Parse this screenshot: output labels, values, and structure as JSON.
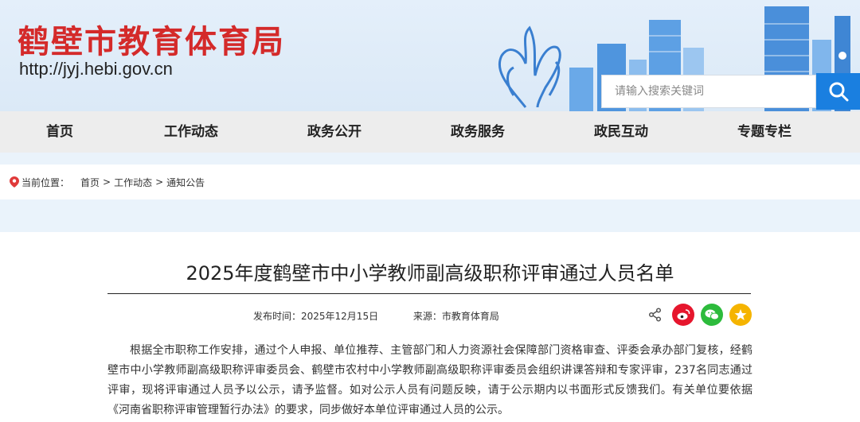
{
  "header": {
    "site_title": "鹤壁市教育体育局",
    "site_url": "http://jyj.hebi.gov.cn",
    "search_placeholder": "请输入搜索关键词"
  },
  "nav": {
    "items": [
      "首页",
      "工作动态",
      "政务公开",
      "政务服务",
      "政民互动",
      "专题专栏"
    ]
  },
  "breadcrumb": {
    "label": "当前位置：",
    "items": [
      "首页",
      "工作动态",
      "通知公告"
    ],
    "separator": ">"
  },
  "article": {
    "title": "2025年度鹤壁市中小学教师副高级职称评审通过人员名单",
    "publish_time": "发布时间：2025年12月15日",
    "source": "来源：市教育体育局",
    "body": "根据全市职称工作安排，通过个人申报、单位推荐、主管部门和人力资源社会保障部门资格审查、评委会承办部门复核，经鹤壁市中小学教师副高级职称评审委员会、鹤壁市农村中小学教师副高级职称评审委员会组织讲课答辩和专家评审，237名同志通过评审，现将评审通过人员予以公示，请予监督。如对公示人员有问题反映，请于公示期内以书面形式反馈我们。有关单位要依据《河南省职称评审管理暂行办法》的要求，同步做好本单位评审通过人员的公示。"
  },
  "colors": {
    "title_red": "#d42a2a",
    "search_blue": "#1a7fe0",
    "weibo_red": "#e6162d",
    "wechat_green": "#2dbb3c",
    "qzone_yellow": "#f5b400"
  }
}
